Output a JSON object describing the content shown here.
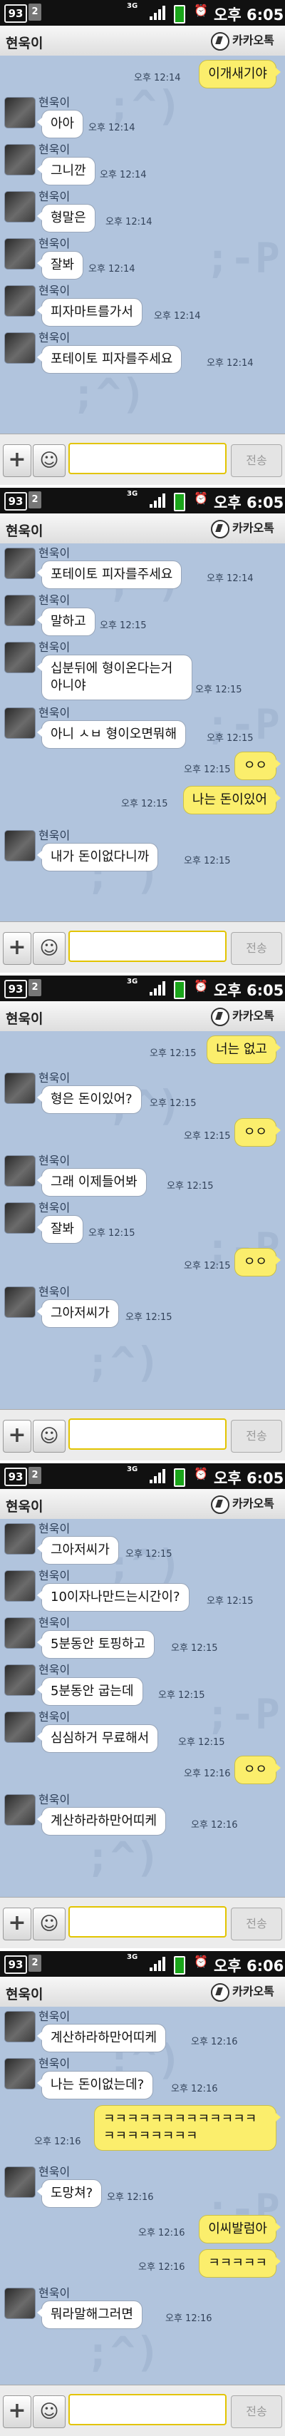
{
  "screens": [
    {
      "statusbar": {
        "badge": "93",
        "card": "2",
        "network": "3G",
        "time": "오후 6:05"
      },
      "header": {
        "chat_name": "현욱이",
        "kakao_label": "카카오톡"
      },
      "input": {
        "send_label": "전송"
      },
      "messages": [
        {
          "type": "out",
          "text": "이개새기야",
          "time": "오후 12:14"
        },
        {
          "type": "in",
          "sender": "현욱이",
          "text": "아아",
          "time": "오후 12:14"
        },
        {
          "type": "in",
          "sender": "현욱이",
          "text": "그니깐",
          "time": "오후 12:14"
        },
        {
          "type": "in",
          "sender": "현욱이",
          "text": "형말은",
          "time": "오후 12:14"
        },
        {
          "type": "in",
          "sender": "현욱이",
          "text": "잘봐",
          "time": "오후 12:14"
        },
        {
          "type": "in",
          "sender": "현욱이",
          "text": "피자마트를가서",
          "time": "오후 12:14"
        },
        {
          "type": "in",
          "sender": "현욱이",
          "text": "포테이토 피자를주세요",
          "time": "오후 12:14"
        }
      ]
    },
    {
      "statusbar": {
        "badge": "93",
        "card": "2",
        "network": "3G",
        "time": "오후 6:05"
      },
      "header": {
        "chat_name": "현욱이",
        "kakao_label": "카카오톡"
      },
      "input": {
        "send_label": "전송"
      },
      "messages": [
        {
          "type": "in",
          "sender": "현욱이",
          "text": "포테이토 피자를주세요",
          "time": "오후 12:14"
        },
        {
          "type": "in",
          "sender": "현욱이",
          "text": "말하고",
          "time": "오후 12:15"
        },
        {
          "type": "in",
          "sender": "현욱이",
          "text": "십분뒤에 형이온다는거아니야",
          "time": "오후 12:15"
        },
        {
          "type": "in",
          "sender": "현욱이",
          "text": "아니 ㅅㅂ 형이오면뭐해",
          "time": "오후 12:15"
        },
        {
          "type": "out",
          "text": "ㅇㅇ",
          "time": "오후 12:15"
        },
        {
          "type": "out",
          "text": "나는 돈이있어",
          "time": "오후 12:15"
        },
        {
          "type": "in",
          "sender": "현욱이",
          "text": "내가 돈이없다니까",
          "time": "오후 12:15"
        }
      ]
    },
    {
      "statusbar": {
        "badge": "93",
        "card": "2",
        "network": "3G",
        "time": "오후 6:05"
      },
      "header": {
        "chat_name": "현욱이",
        "kakao_label": "카카오톡"
      },
      "input": {
        "send_label": "전송"
      },
      "messages": [
        {
          "type": "out",
          "text": "너는 없고",
          "time": "오후 12:15"
        },
        {
          "type": "in",
          "sender": "현욱이",
          "text": "형은 돈이있어?",
          "time": "오후 12:15"
        },
        {
          "type": "out",
          "text": "ㅇㅇ",
          "time": "오후 12:15"
        },
        {
          "type": "in",
          "sender": "현욱이",
          "text": "그래 이제들어봐",
          "time": "오후 12:15"
        },
        {
          "type": "in",
          "sender": "현욱이",
          "text": "잘봐",
          "time": "오후 12:15"
        },
        {
          "type": "out",
          "text": "ㅇㅇ",
          "time": "오후 12:15"
        },
        {
          "type": "in",
          "sender": "현욱이",
          "text": "그아저씨가",
          "time": "오후 12:15"
        }
      ]
    },
    {
      "statusbar": {
        "badge": "93",
        "card": "2",
        "network": "3G",
        "time": "오후 6:05"
      },
      "header": {
        "chat_name": "현욱이",
        "kakao_label": "카카오톡"
      },
      "input": {
        "send_label": "전송"
      },
      "messages": [
        {
          "type": "in",
          "sender": "현욱이",
          "text": "그아저씨가",
          "time": "오후 12:15"
        },
        {
          "type": "in",
          "sender": "현욱이",
          "text": "10이자나만드는시간이?",
          "time": "오후 12:15"
        },
        {
          "type": "in",
          "sender": "현욱이",
          "text": "5분동안 토핑하고",
          "time": "오후 12:15"
        },
        {
          "type": "in",
          "sender": "현욱이",
          "text": "5분동안 굽는데",
          "time": "오후 12:15"
        },
        {
          "type": "in",
          "sender": "현욱이",
          "text": "심심하거 무료해서",
          "time": "오후 12:15"
        },
        {
          "type": "out",
          "text": "ㅇㅇ",
          "time": "오후 12:16"
        },
        {
          "type": "in",
          "sender": "현욱이",
          "text": "계산하라하만어띠케",
          "time": "오후 12:16"
        }
      ]
    },
    {
      "statusbar": {
        "badge": "93",
        "card": "2",
        "network": "3G",
        "time": "오후 6:06"
      },
      "header": {
        "chat_name": "현욱이",
        "kakao_label": "카카오톡"
      },
      "input": {
        "send_label": "전송"
      },
      "messages": [
        {
          "type": "in",
          "sender": "현욱이",
          "text": "계산하라하만어띠케",
          "time": "오후 12:16"
        },
        {
          "type": "in",
          "sender": "현욱이",
          "text": "나는 돈이없는데?",
          "time": "오후 12:16"
        },
        {
          "type": "out",
          "text": "ㅋㅋㅋㅋㅋㅋㅋㅋㅋㅋㅋㅋㅋㅋㅋㅋㅋㅋㅋㅋㅋ",
          "time": "오후 12:16"
        },
        {
          "type": "in",
          "sender": "현욱이",
          "text": "도망쳐?",
          "time": "오후 12:16"
        },
        {
          "type": "out",
          "text": "이씨발럼아",
          "time": "오후 12:16"
        },
        {
          "type": "out",
          "text": "ㅋㅋㅋㅋㅋ",
          "time": "오후 12:16"
        },
        {
          "type": "in",
          "sender": "현욱이",
          "text": "뭐라말해그러면",
          "time": "오후 12:16"
        }
      ]
    }
  ]
}
